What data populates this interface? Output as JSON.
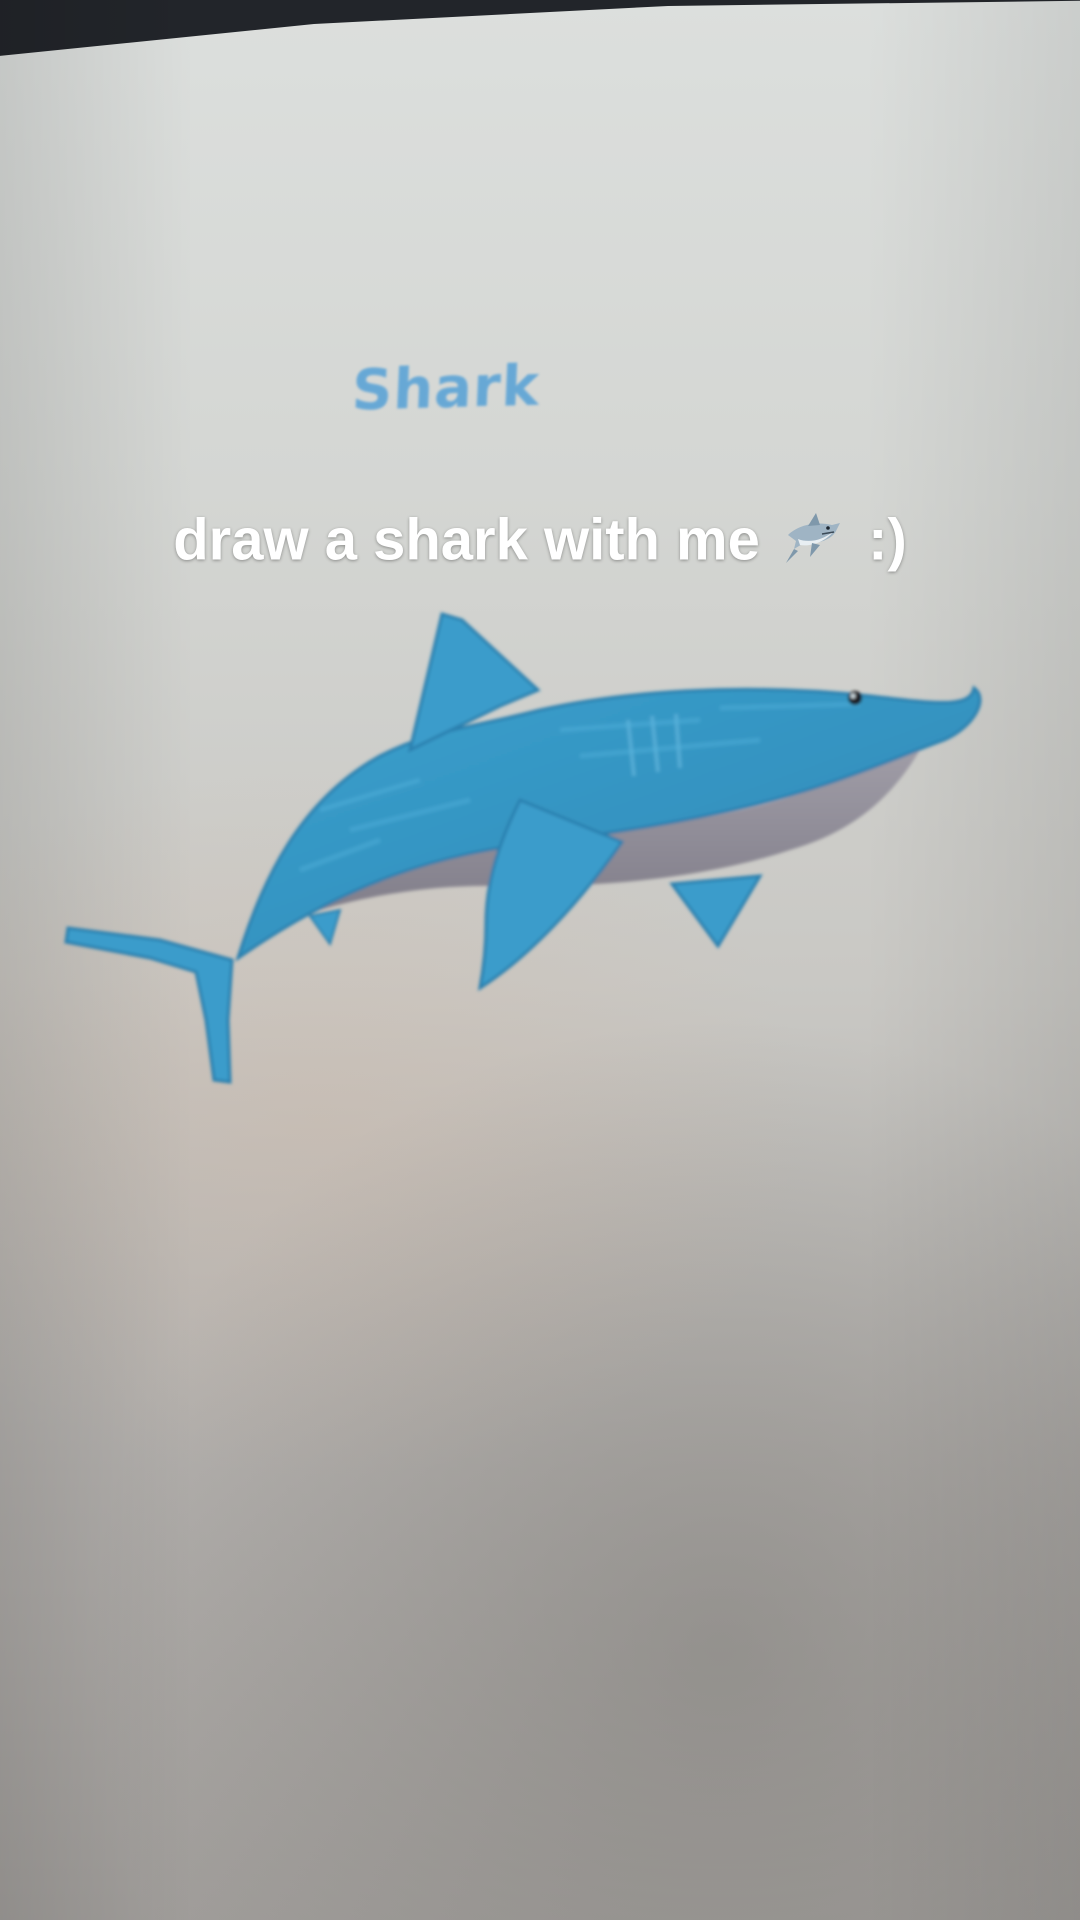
{
  "paper": {
    "handwritten_title": "Shark"
  },
  "overlay": {
    "caption_text": "draw a shark with me",
    "caption_suffix": ":)",
    "caption_emoji": "shark-emoji-icon"
  },
  "drawing": {
    "subject": "shark-drawing",
    "body_color": "#3b9ac8",
    "belly_color": "#8e8a95"
  }
}
